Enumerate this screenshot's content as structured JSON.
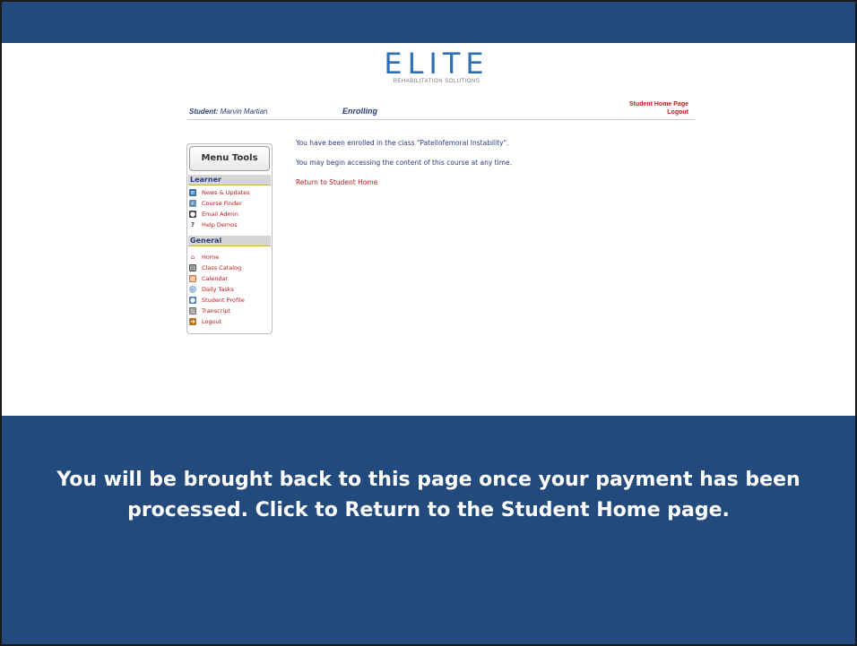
{
  "slide": {
    "caption": "You will be brought back to this page once your payment has been processed.  Click to Return to the Student Home page."
  },
  "brand": {
    "logo_text": "ELITE",
    "logo_sub": "REHABILITATION SOLUTIONS",
    "accent_color": "#234a7d",
    "link_color": "#b81d1d"
  },
  "header": {
    "student_label": "Student:",
    "student_name": "Marvin Martian",
    "page_title": "Enrolling",
    "home_link": "Student Home Page",
    "logout_link": "Logout"
  },
  "sidebar": {
    "menu_label": "Menu Tools",
    "sections": [
      {
        "title": "Learner",
        "items": [
          {
            "label": "News & Updates",
            "icon": "news-icon"
          },
          {
            "label": "Course Finder",
            "icon": "search-icon"
          },
          {
            "label": "Email Admin",
            "icon": "user-icon"
          },
          {
            "label": "Help Demos",
            "icon": "help-icon"
          }
        ]
      },
      {
        "title": "General",
        "items": [
          {
            "label": "Home",
            "icon": "home-icon"
          },
          {
            "label": "Class Catalog",
            "icon": "catalog-icon"
          },
          {
            "label": "Calendar",
            "icon": "calendar-icon"
          },
          {
            "label": "Daily Tasks",
            "icon": "clock-icon"
          },
          {
            "label": "Student Profile",
            "icon": "profile-icon"
          },
          {
            "label": "Transcript",
            "icon": "transcript-icon"
          },
          {
            "label": "Logout",
            "icon": "logout-icon"
          }
        ]
      }
    ]
  },
  "main": {
    "line1": "You have been enrolled in the class \"Patellofemoral Instability\".",
    "line2": "You may begin accessing the content of this course at any time.",
    "return_link": "Return to Student Home"
  }
}
